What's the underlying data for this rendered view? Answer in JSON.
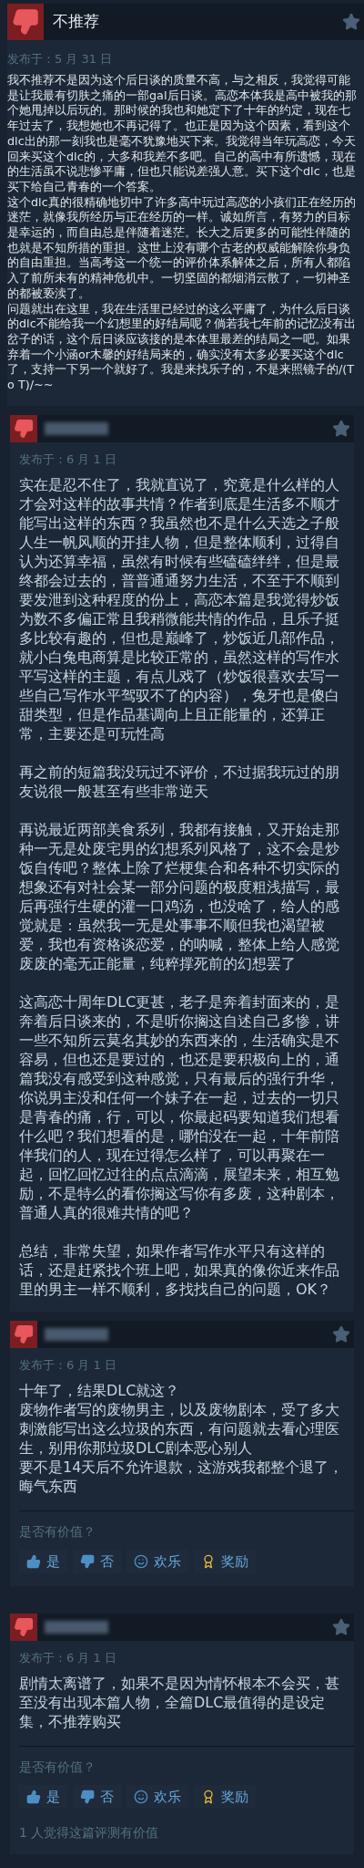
{
  "reviews": [
    {
      "header": {
        "kind": "title",
        "title": "不推荐"
      },
      "recommended": false,
      "posted": "发布于：5 月 31 日",
      "paragraphs": [
        "我不推荐不是因为这个后日谈的质量不高，与之相反，我觉得可能是让我最有切肤之痛的一部gal后日谈。高恋本体我是高中被我的那个她甩掉以后玩的。那时候的我也和她定下了十年的约定，现在七年过去了，我想她也不再记得了。也正是因为这个因素，看到这个dlc出的那一刻我也是毫不犹豫地买下来。我觉得当年玩高恋，今天回来买这个dlc的，大多和我差不多吧。自己的高中有所遗憾，现在的生活虽不说悲惨平庸，但也只能说差强人意。买下这个dlc，也是买下给自己青春的一个答案。",
        "这个dlc真的很精确地切中了许多高中玩过高恋的小孩们正在经历的迷茫，就像我所经历与正在经历的一样。诚如所言，有努力的目标是幸运的，而自由总是伴随着迷茫。长大之后更多的可能性伴随的也就是不知所措的重担。这世上没有哪个古老的权威能解除你身负的自由重担。当高考这一个统一的评价体系解体之后，所有人都陷入了前所未有的精神危机中。一切坚固的都烟消云散了，一切神圣的都被亵渎了。",
        "问题就出在这里，我在生活里已经过的这么平庸了，为什么后日谈的dlc不能给我一个幻想里的好结局呢？倘若我七年前的记忆没有出岔子的话，这个后日谈应该接的是本体里最差的结局之一吧。如果弃着一个小涵or木馨的好结局来的，确实没有太多必要买这个dlc了，支持一下另一个就好了。我是来找乐子的，不是来照镜子的/(T o T)/~~"
      ]
    },
    {
      "header": {
        "kind": "redacted"
      },
      "recommended": false,
      "posted": "发布于：6 月 1 日",
      "paragraphs": [
        "实在是忍不住了，我就直说了，究竟是什么样的人才会对这样的故事共情？作者到底是生活多不顺才能写出这样的东西？我虽然也不是什么天选之子般人生一帆风顺的开挂人物，但是整体顺利，过得自认为还算幸福，虽然有时候有些磕磕绊绊，但是最终都会过去的，普普通通努力生活，不至于不顺到要发泄到这种程度的份上，高恋本篇是我觉得炒饭为数不多偏正常且我稍微能共情的作品，且乐子挺多比较有趣的，但也是巅峰了，炒饭近几部作品，就小白兔电商算是比较正常的，虽然这样的写作水平写这样的主题，有点儿戏了（炒饭很喜欢去写一些自己写作水平驾驭不了的内容），兔牙也是傻白甜类型，但是作品基调向上且正能量的，还算正常，主要还是可玩性高",
        "再之前的短篇我没玩过不评价，不过据我玩过的朋友说很一般甚至有些非常逆天",
        "再说最近两部美食系列，我都有接触，又开始走那种一无是处废宅男的幻想系列风格了，这不会是炒饭自传吧？整体上除了烂梗集合和各种不切实际的想象还有对社会某一部分问题的极度粗浅描写，最后再强行生硬的灌一口鸡汤，也没啥了，给人的感觉就是：虽然我一无是处事事不顺但我也渴望被爱，我也有资格谈恋爱，的呐喊，整体上给人感觉废废的毫无正能量，纯粹撑死前的幻想罢了",
        "这高恋十周年DLC更甚，老子是奔着封面来的，是奔着后日谈来的，不是听你搁这自述自己多惨，讲一些不知所云莫名其妙的东西来的，生活确实是不容易，但也还是要过的，也还是要积极向上的，通篇我没有感受到这种感觉，只有最后的强行升华，你说男主没和任何一个妹子在一起，过去的一切只是青春的痛，行，可以，你最起码要知道我们想看什么吧？我们想看的是，哪怕没在一起，十年前陪伴我们的人，现在过得怎么样了，可以再聚在一起，回忆回忆过往的点点滴滴，展望未来，相互勉励，不是特么的看你搁这写你有多废，这种剧本，普通人真的很难共情的吧？",
        "总结，非常失望，如果作者写作水平只有这样的话，还是赶紧找个班上吧，如果真的像你近来作品里的男主一样不顺利，多找找自己的问题，OK？"
      ]
    },
    {
      "header": {
        "kind": "redacted"
      },
      "recommended": false,
      "posted": "发布于：6 月 1 日",
      "paragraphs": [
        "十年了，结果DLC就这？",
        "废物作者写的废物男主，以及废物剧本，受了多大刺激能写出这么垃圾的东西，有问题就去看心理医生，别用你那垃圾DLC剧本恶心别人",
        "要不是14天后不允许退款，这游戏我都整个退了，晦气东西"
      ],
      "helpful_prompt": "是否有价值？",
      "votes": [
        {
          "kind": "yes",
          "label": "是"
        },
        {
          "kind": "no",
          "label": "否"
        },
        {
          "kind": "funny",
          "label": "欢乐"
        },
        {
          "kind": "award",
          "label": "奖励"
        }
      ]
    },
    {
      "header": {
        "kind": "redacted"
      },
      "recommended": false,
      "posted": "发布于：6 月 1 日",
      "paragraphs": [
        "剧情太离谱了，如果不是因为情怀根本不会买，甚至没有出现本篇人物，全篇DLC最值得的是设定集，不推荐购买"
      ],
      "helpful_prompt": "是否有价值？",
      "votes": [
        {
          "kind": "yes",
          "label": "是"
        },
        {
          "kind": "no",
          "label": "否"
        },
        {
          "kind": "funny",
          "label": "欢乐"
        },
        {
          "kind": "award",
          "label": "奖励"
        }
      ],
      "helpful_count": "1 人觉得这篇评测有价值"
    }
  ]
}
